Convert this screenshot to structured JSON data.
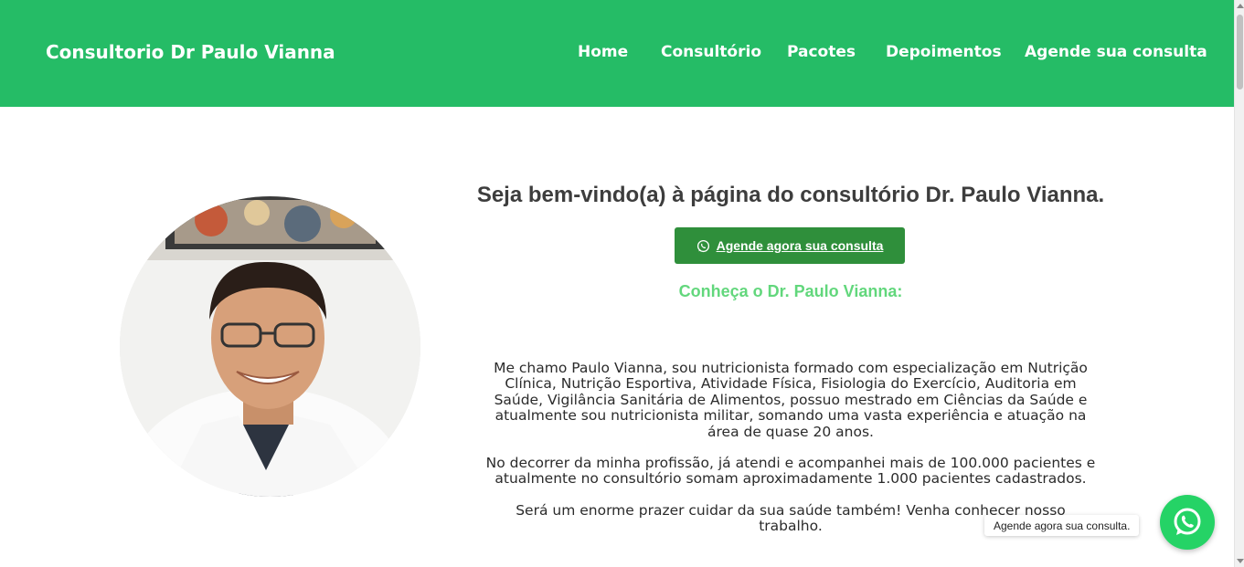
{
  "header": {
    "brand": "Consultorio Dr Paulo Vianna",
    "nav": [
      "Home",
      "Consultório",
      "Pacotes",
      "Depoimentos",
      "Agende sua consulta"
    ],
    "background_color": "#25bc66"
  },
  "main": {
    "welcome_title": "Seja bem-vindo(a) à página do consultório Dr. Paulo Vianna.",
    "cta_label": "Agende agora sua consulta",
    "subheading": "Conheça o Dr. Paulo Vianna:",
    "bio_paragraphs": [
      [
        "Me chamo Paulo Vianna, sou nutricionista formado com especialização em Nutrição",
        "Clínica, Nutrição Esportiva, Atividade Física, Fisiologia do Exercício, Auditoria em",
        "Saúde, Vigilância Sanitária de Alimentos, possuo mestrado em Ciências da Saúde e",
        "atualmente sou nutricionista militar, somando uma vasta experiência e atuação na",
        "área de quase 20 anos."
      ],
      [
        "No decorrer da minha profissão, já atendi e acompanhei mais de 100.000 pacientes e",
        "atualmente no consultório somam aproximadamente 1.000 pacientes cadastrados."
      ],
      [
        "Será um enorme prazer cuidar da sua saúde também! Venha conhecer nosso trabalho."
      ]
    ],
    "accent_color": "#62d77c",
    "button_color": "#2f8f3b"
  },
  "whatsapp_float": {
    "label": "Agende agora sua consulta.",
    "icon": "whatsapp-icon",
    "color": "#25d366"
  }
}
